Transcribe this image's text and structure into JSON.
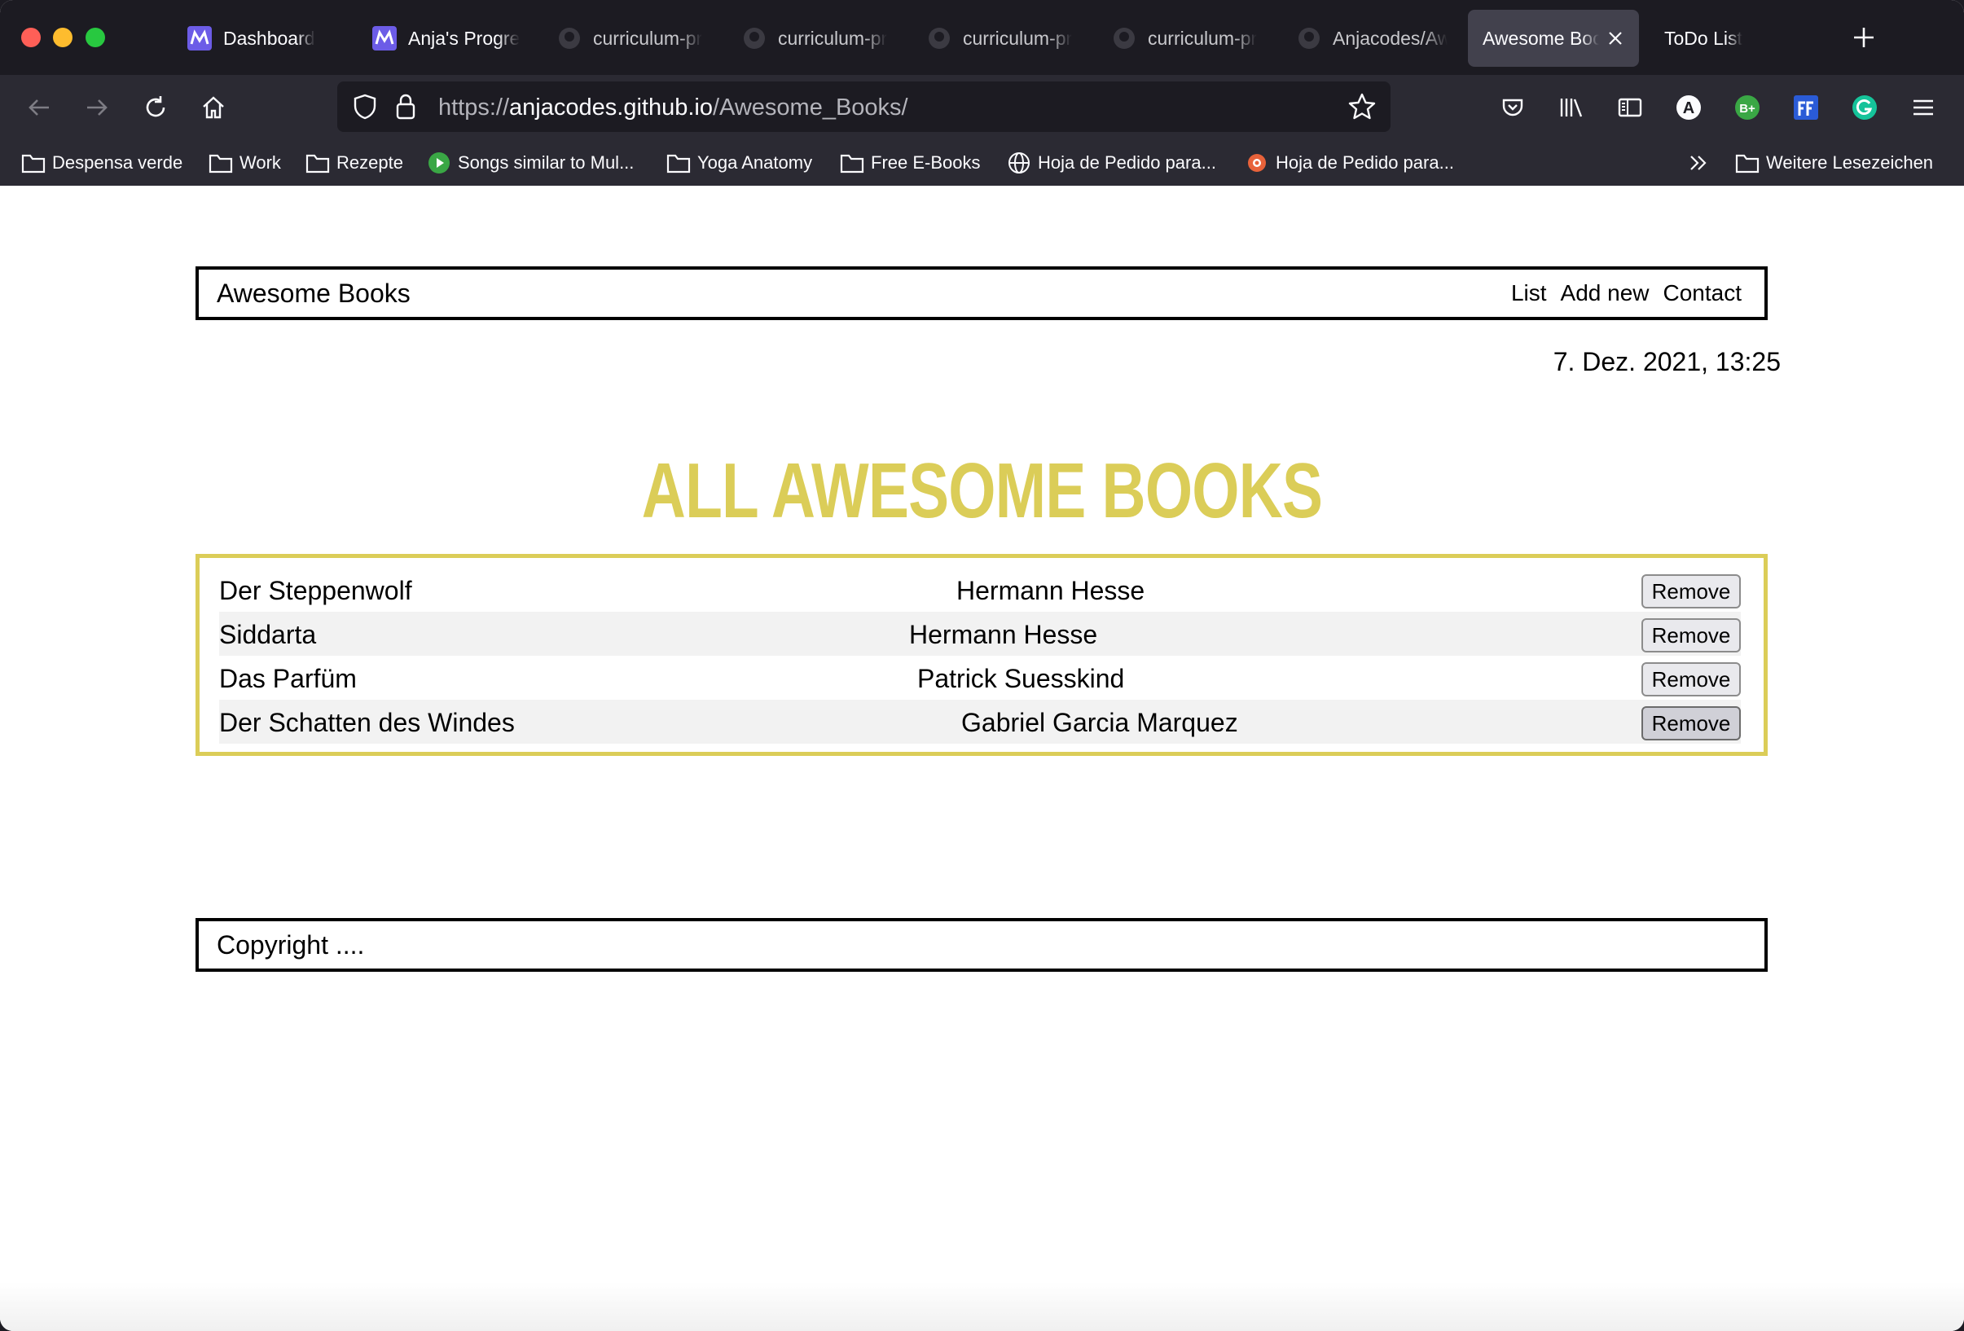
{
  "browser": {
    "tabs": [
      {
        "label": "Dashboard",
        "icon": "microverse-icon"
      },
      {
        "label": "Anja's Progre",
        "icon": "microverse-icon"
      },
      {
        "label": "curriculum-pr",
        "icon": "github-icon"
      },
      {
        "label": "curriculum-pr",
        "icon": "github-icon"
      },
      {
        "label": "curriculum-pr",
        "icon": "github-icon"
      },
      {
        "label": "curriculum-pr",
        "icon": "github-icon"
      },
      {
        "label": "Anjacodes/Aw",
        "icon": "github-icon"
      },
      {
        "label": "Awesome Book",
        "icon": "",
        "active": true
      },
      {
        "label": "ToDo List",
        "icon": ""
      }
    ],
    "url": {
      "scheme": "https://",
      "domain": "anjacodes.github.io",
      "path": "/Awesome_Books/"
    },
    "bookmarks": [
      {
        "label": "Despensa verde",
        "icon": "folder-icon"
      },
      {
        "label": "Work",
        "icon": "folder-icon"
      },
      {
        "label": "Rezepte",
        "icon": "folder-icon"
      },
      {
        "label": "Songs similar to Mul...",
        "icon": "music-icon"
      },
      {
        "label": "Yoga Anatomy",
        "icon": "folder-icon"
      },
      {
        "label": "Free E-Books",
        "icon": "folder-icon"
      },
      {
        "label": "Hoja de Pedido para...",
        "icon": "globe-icon"
      },
      {
        "label": "Hoja de Pedido para...",
        "icon": "site-icon"
      }
    ],
    "other_bookmarks": "Weitere Lesezeichen",
    "extension_badges": {
      "a": "A",
      "bplus": "B+"
    }
  },
  "page": {
    "logo": "Awesome Books",
    "nav": {
      "list": "List",
      "add_new": "Add new",
      "contact": "Contact"
    },
    "datetime": "7. Dez. 2021, 13:25",
    "heading": "ALL AWESOME BOOKS",
    "books": [
      {
        "title": "Der Steppenwolf",
        "author": "Hermann Hesse",
        "remove": "Remove"
      },
      {
        "title": "Siddarta",
        "author": "Hermann Hesse",
        "remove": "Remove"
      },
      {
        "title": "Das Parfüm",
        "author": "Patrick Suesskind",
        "remove": "Remove"
      },
      {
        "title": "Der Schatten des Windes",
        "author": "Gabriel Garcia Marquez",
        "remove": "Remove"
      }
    ],
    "footer": "Copyright ....",
    "colors": {
      "accent": "#dbcd58",
      "row_alt": "#f2f2f2",
      "border": "#000000"
    }
  }
}
